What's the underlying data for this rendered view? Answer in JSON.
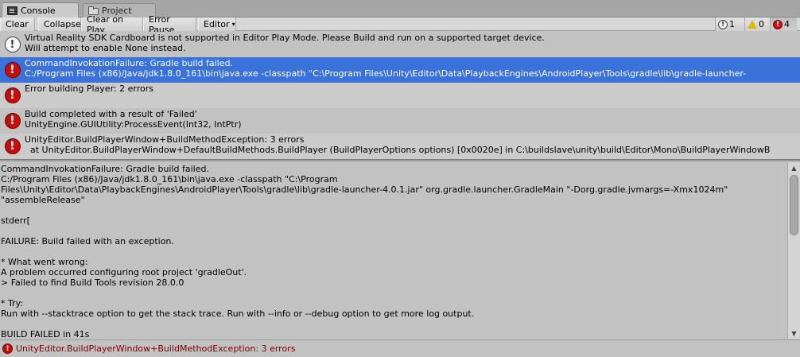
{
  "tabs": [
    {
      "label": "Console",
      "icon": "console-icon",
      "active": true
    },
    {
      "label": "Project",
      "icon": "folder-icon",
      "active": false
    }
  ],
  "toolbar": {
    "clear": "Clear",
    "collapse": "Collapse",
    "clear_on_play": "Clear on Play",
    "error_pause": "Error Pause",
    "editor": "Editor",
    "editor_arrow": "▾",
    "counts": {
      "info": "1",
      "warn": "0",
      "error": "4"
    }
  },
  "logs": [
    {
      "type": "info",
      "line1": "Virtual Reality SDK Cardboard is not supported in Editor Play Mode. Please Build and run on a supported target device.",
      "line2": "Will attempt to enable None instead."
    },
    {
      "type": "error",
      "selected": true,
      "line1": "CommandInvokationFailure: Gradle build failed.",
      "line2": "C:/Program Files (x86)/Java/jdk1.8.0_161\\bin\\java.exe -classpath \"C:\\Program Files\\Unity\\Editor\\Data\\PlaybackEngines\\AndroidPlayer\\Tools\\gradle\\lib\\gradle-launcher-"
    },
    {
      "type": "error",
      "line1": "Error building Player: 2 errors",
      "line2": ""
    },
    {
      "type": "error",
      "line1": "Build completed with a result of 'Failed'",
      "line2": "UnityEngine.GUIUtility:ProcessEvent(Int32, IntPtr)"
    },
    {
      "type": "error",
      "line1": "UnityEditor.BuildPlayerWindow+BuildMethodException: 3 errors",
      "line2": "  at UnityEditor.BuildPlayerWindow+DefaultBuildMethods.BuildPlayer (BuildPlayerOptions options) [0x0020e] in C:\\buildslave\\unity\\build\\Editor\\Mono\\BuildPlayerWindowB"
    }
  ],
  "detail": {
    "text": "CommandInvokationFailure: Gradle build failed.\nC:/Program Files (x86)/Java/jdk1.8.0_161\\bin\\java.exe -classpath \"C:\\Program\nFiles\\Unity\\Editor\\Data\\PlaybackEngines\\AndroidPlayer\\Tools\\gradle\\lib\\gradle-launcher-4.0.1.jar\" org.gradle.launcher.GradleMain \"-Dorg.gradle.jvmargs=-Xmx1024m\"\n\"assembleRelease\"\n\nstderr[\n\nFAILURE: Build failed with an exception.\n\n* What went wrong:\nA problem occurred configuring root project 'gradleOut'.\n> Failed to find Build Tools revision 28.0.0\n\n* Try:\nRun with --stacktrace option to get the stack trace. Run with --info or --debug option to get more log output.\n\nBUILD FAILED in 41s"
  },
  "status": {
    "message": "UnityEditor.BuildPlayerWindow+BuildMethodException: 3 errors"
  }
}
